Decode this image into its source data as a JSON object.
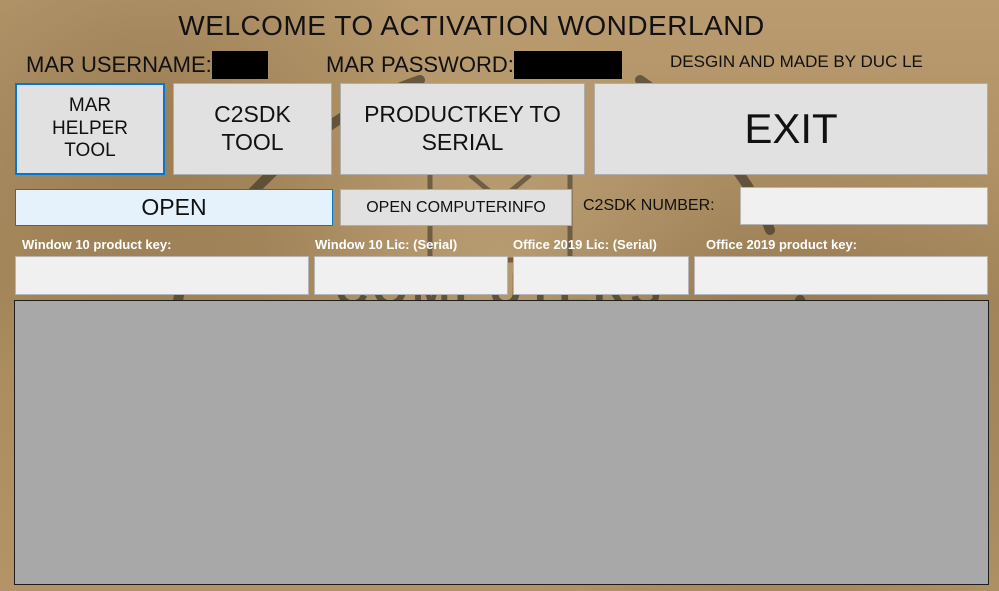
{
  "window": {
    "title": "WELCOME TO ACTIVATION WONDERLAND",
    "credit": "DESGIN AND MADE BY DUC LE"
  },
  "credentials": {
    "username_label": "MAR USERNAME:",
    "password_label": "MAR PASSWORD:"
  },
  "buttons": {
    "mar_helper_tool": [
      "MAR",
      "HELPER",
      "TOOL"
    ],
    "c2sdk_tool": [
      "C2SDK",
      "TOOL"
    ],
    "productkey_to_serial": [
      "PRODUCTKEY TO",
      "SERIAL"
    ],
    "exit": "EXIT",
    "open": "OPEN",
    "open_computerinfo": "OPEN COMPUTERINFO"
  },
  "c2sdk": {
    "label": "C2SDK NUMBER:",
    "value": ""
  },
  "fields": [
    {
      "label": "Window 10 product key:",
      "value": ""
    },
    {
      "label": "Window 10 Lic: (Serial)",
      "value": ""
    },
    {
      "label": "Office 2019 Lic: (Serial)",
      "value": ""
    },
    {
      "label": "Office 2019 product key:",
      "value": ""
    }
  ],
  "colors": {
    "button_face": "#e1e1e1",
    "focus_border": "#0078d7",
    "output_area": "#a8a8a8"
  }
}
